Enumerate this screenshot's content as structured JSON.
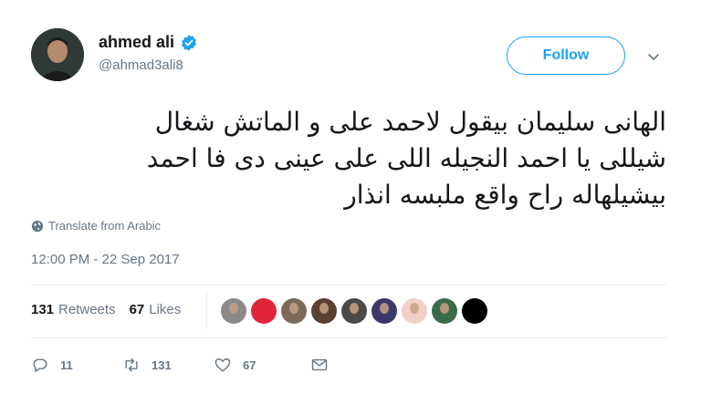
{
  "tweet": {
    "author": {
      "display_name": "ahmed ali",
      "handle": "@ahmad3ali8",
      "verified": true
    },
    "follow_label": "Follow",
    "text": "الهانى سليمان بيقول لاحمد على و الماتش شغال\nشيللى يا احمد النجيله اللى على عينى دى فا احمد\nبيشيلهاله راح واقع ملبسه انذار",
    "translate_label": "Translate from Arabic",
    "timestamp": "12:00 PM - 22 Sep 2017",
    "stats": {
      "retweets_count": "131",
      "retweets_label": "Retweets",
      "likes_count": "67",
      "likes_label": "Likes"
    },
    "likers": [
      {
        "color": "#8a8a8a"
      },
      {
        "color": "#e0243a"
      },
      {
        "color": "#7a6a5a"
      },
      {
        "color": "#5a4030"
      },
      {
        "color": "#4a4a4a"
      },
      {
        "color": "#3a3a6a"
      },
      {
        "color": "#f2d0c8"
      },
      {
        "color": "#3a6a4a"
      },
      {
        "color": "#000000"
      }
    ],
    "actions": {
      "reply_count": "11",
      "retweet_count": "131",
      "like_count": "67"
    },
    "colors": {
      "accent": "#1da1f2",
      "secondary_text": "#657786",
      "divider": "#e6ecf0"
    }
  }
}
